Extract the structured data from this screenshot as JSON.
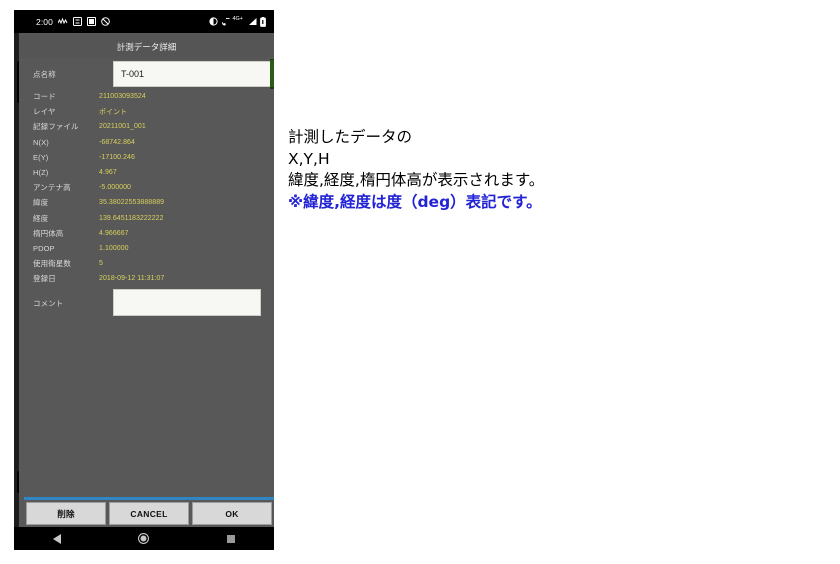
{
  "phone": {
    "status_bar": {
      "clock": "2:00",
      "left_icons": [
        "signal-wave-icon",
        "sd-card-icon",
        "image-icon",
        "sync-disabled-icon"
      ],
      "right_icons": [
        "brightness-icon",
        "call-4g-icon",
        "signal-bars-icon",
        "battery-icon"
      ],
      "network_label": "4G+"
    },
    "dialog": {
      "title": "計測データ詳細",
      "name_field": {
        "label": "点名称",
        "value": "T-001",
        "placeholder": ""
      },
      "fields": [
        {
          "label": "コード",
          "value": "211003093524"
        },
        {
          "label": "レイヤ",
          "value": "ポイント"
        },
        {
          "label": "記録ファイル",
          "value": "20211001_001"
        },
        {
          "label": "N(X)",
          "value": "-68742.864"
        },
        {
          "label": "E(Y)",
          "value": "-17100.246"
        },
        {
          "label": "H(Z)",
          "value": "4.967"
        },
        {
          "label": "アンテナ高",
          "value": "-5.000000"
        },
        {
          "label": "緯度",
          "value": "35.38022553888889"
        },
        {
          "label": "経度",
          "value": "139.6451183222222"
        },
        {
          "label": "楕円体高",
          "value": "4.966667"
        },
        {
          "label": "PDOP",
          "value": "1.100000"
        },
        {
          "label": "使用衛星数",
          "value": "5"
        },
        {
          "label": "登録日",
          "value": "2018-09-12 11:31:07"
        }
      ],
      "comment_field": {
        "label": "コメント",
        "value": "",
        "placeholder": ""
      },
      "buttons": [
        {
          "label": "削除",
          "name": "delete-button"
        },
        {
          "label": "CANCEL",
          "name": "cancel-button"
        },
        {
          "label": "OK",
          "name": "ok-button"
        }
      ]
    },
    "nav_bar": {
      "back": "back-triangle-icon",
      "home": "home-circle-icon",
      "recents": "recents-square-icon"
    }
  },
  "annotation": {
    "line1": "計測したデータの",
    "line2": "X,Y,H",
    "line3": "緯度,経度,楕円体高が表示されます。",
    "line4": "※緯度,経度は度（deg）表記です。"
  },
  "colors": {
    "accent_blue": "#2f86c5",
    "value_yellow": "#d9d05e",
    "dialog_bg": "#585858",
    "annotation_highlight": "#2323d6"
  }
}
